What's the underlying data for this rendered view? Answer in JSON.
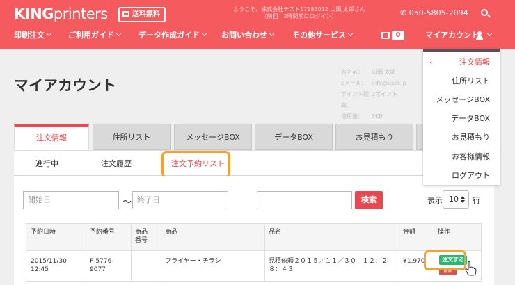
{
  "header": {
    "logo_bold": "KING",
    "logo_light": "printers",
    "badge": "送料無料",
    "welcome_line1": "ようこそ、株式会社テスト17183012 山田 太郎さん",
    "welcome_line2": "（前回　2時間前にログイン）",
    "phone": "050-5805-2094"
  },
  "nav": {
    "items": [
      {
        "label": "印刷注文"
      },
      {
        "label": "ご利用ガイド"
      },
      {
        "label": "データ作成ガイド"
      },
      {
        "label": "お問い合わせ"
      },
      {
        "label": "その他サービス"
      }
    ],
    "cart_count": "0",
    "account_label": "マイアカウント"
  },
  "page": {
    "title": "マイアカウント"
  },
  "account": {
    "rows": [
      {
        "key": "お名前：",
        "value": "山田 太郎"
      },
      {
        "key": "Eメール：",
        "value": "info@user.jp"
      },
      {
        "key": "ポイント残高：",
        "value": "3ポイント"
      },
      {
        "key": "使用量：",
        "value": "5KB"
      }
    ]
  },
  "tabs": [
    {
      "label": "注文情報"
    },
    {
      "label": "住所リスト"
    },
    {
      "label": "メッセージBOX"
    },
    {
      "label": "データBOX"
    },
    {
      "label": "お見積もり"
    }
  ],
  "subtabs": [
    {
      "label": "進行中"
    },
    {
      "label": "注文履歴"
    },
    {
      "label": "注文予約リスト"
    }
  ],
  "filters": {
    "start_placeholder": "開始日",
    "end_placeholder": "終了日",
    "tilde": "〜",
    "search_label": "検索",
    "per_page_label": "表示",
    "per_page_value": "10",
    "per_page_unit": "行"
  },
  "table": {
    "headers": [
      "予約日時",
      "予約番号",
      "商品番号",
      "商品",
      "品名",
      "金額",
      "操作"
    ],
    "rows": [
      {
        "date": "2015/11/30",
        "time": "12:45",
        "reservation_no_1": "F-5776-",
        "reservation_no_2": "9077",
        "product_no": "",
        "product": "フライヤー・チラシ",
        "item_name_1": "見積依頼２０１５／１１／３０　１２：２",
        "item_name_2": "８：４３",
        "amount": "¥1,970",
        "order_label": "注文する",
        "delete_label": "削除"
      }
    ]
  },
  "dropdown": {
    "caret": "‹",
    "items": [
      {
        "label": "注文情報"
      },
      {
        "label": "住所リスト"
      },
      {
        "label": "メッセージBOX"
      },
      {
        "label": "データBOX"
      },
      {
        "label": "お見積もり"
      },
      {
        "label": "お客様情報"
      },
      {
        "label": "ログアウト"
      }
    ]
  },
  "colors": {
    "brand": "#f45a5e",
    "accent": "#e8484f",
    "highlight": "#f3a22d",
    "order_button": "#2bb673"
  }
}
